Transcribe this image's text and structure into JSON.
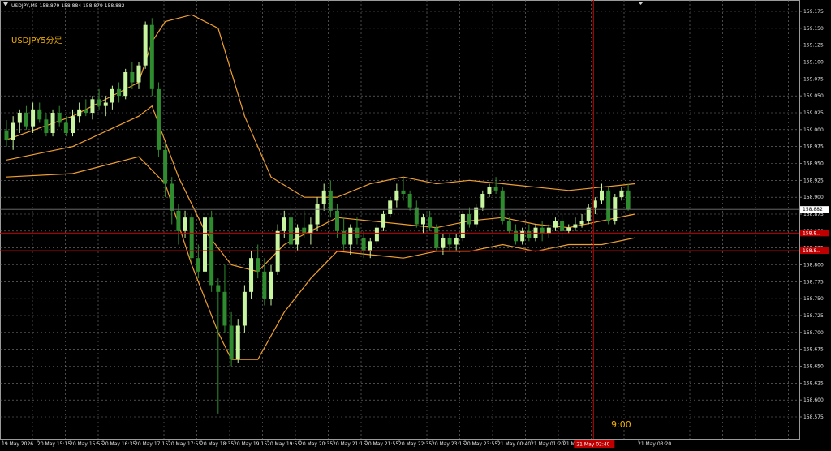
{
  "window": {
    "symbol_header": "USDJPY,M5  158.879 158.884 158.879 158.882",
    "subtitle": "USDJPY5分足"
  },
  "colors": {
    "background": "#000000",
    "grid": "#7a7a7a",
    "bull_candle": "#c8f5a0",
    "bear_candle": "#2e8b2e",
    "bollinger": "#f0a030",
    "level_line": "#c00000",
    "crosshair": "#c00000",
    "price_tag_red": "#c00000",
    "current_price_tag": "#ffffff",
    "axis_text": "#e6e6e6",
    "subtitle_text": "#f0b000"
  },
  "price_axis": {
    "labels": [
      "159.175",
      "159.150",
      "159.125",
      "159.100",
      "159.075",
      "159.050",
      "159.025",
      "159.000",
      "158.975",
      "158.950",
      "158.925",
      "158.900",
      "158.875",
      "158.850",
      "158.825",
      "158.800",
      "158.775",
      "158.750",
      "158.725",
      "158.700",
      "158.675",
      "158.650",
      "158.625",
      "158.600",
      "158.575"
    ],
    "current_price": "158.882",
    "level_tags": [
      "158.8..",
      "158.8.."
    ]
  },
  "time_axis": {
    "labels": [
      "19 May 2026",
      "20 May 15:15",
      "20 May 15:55",
      "20 May 16:35",
      "20 May 17:15",
      "20 May 17:55",
      "20 May 18:35",
      "20 May 19:15",
      "20 May 19:55",
      "20 May 20:35",
      "20 May 21:15",
      "20 May 21:55",
      "20 May 22:35",
      "20 May 23:15",
      "20 May 23:55",
      "21 May 00:40",
      "21 May 01:20",
      "21 May 02:00",
      "21 May 03:20"
    ],
    "crosshair_time_tag": "21 May 02:40"
  },
  "crosshair_label": "9:00",
  "chart_data": {
    "type": "candlestick",
    "symbol": "USDJPY",
    "timeframe": "M5",
    "ylim": [
      158.575,
      159.175
    ],
    "grid": true,
    "levels": [
      158.847,
      158.821
    ],
    "last_close": 158.882,
    "candles": [
      [
        158.999,
        159.014,
        158.975,
        158.985
      ],
      [
        158.985,
        159.02,
        158.97,
        159.01
      ],
      [
        159.01,
        159.03,
        158.995,
        159.025
      ],
      [
        159.025,
        159.035,
        159.0,
        159.005
      ],
      [
        159.005,
        159.04,
        158.995,
        159.03
      ],
      [
        159.03,
        159.04,
        159.01,
        159.015
      ],
      [
        159.015,
        159.025,
        158.99,
        158.995
      ],
      [
        158.995,
        159.03,
        158.99,
        159.025
      ],
      [
        159.025,
        159.035,
        159.005,
        159.01
      ],
      [
        159.01,
        159.02,
        158.99,
        158.995
      ],
      [
        158.995,
        159.03,
        158.99,
        159.02
      ],
      [
        159.02,
        159.04,
        159.01,
        159.03
      ],
      [
        159.03,
        159.045,
        159.02,
        159.025
      ],
      [
        159.025,
        159.05,
        159.015,
        159.045
      ],
      [
        159.045,
        159.06,
        159.03,
        159.035
      ],
      [
        159.035,
        159.05,
        159.02,
        159.04
      ],
      [
        159.04,
        159.065,
        159.03,
        159.06
      ],
      [
        159.06,
        159.07,
        159.04,
        159.05
      ],
      [
        159.05,
        159.09,
        159.045,
        159.085
      ],
      [
        159.085,
        159.1,
        159.06,
        159.07
      ],
      [
        159.07,
        159.1,
        159.06,
        159.095
      ],
      [
        159.095,
        159.16,
        159.09,
        159.155
      ],
      [
        159.155,
        159.165,
        159.05,
        159.06
      ],
      [
        159.06,
        159.07,
        158.96,
        158.97
      ],
      [
        158.97,
        158.98,
        158.9,
        158.92
      ],
      [
        158.92,
        158.93,
        158.86,
        158.88
      ],
      [
        158.88,
        158.89,
        158.83,
        158.85
      ],
      [
        158.85,
        158.88,
        158.84,
        158.87
      ],
      [
        158.87,
        158.875,
        158.8,
        158.81
      ],
      [
        158.81,
        158.83,
        158.78,
        158.79
      ],
      [
        158.79,
        158.88,
        158.78,
        158.87
      ],
      [
        158.87,
        158.88,
        158.76,
        158.77
      ],
      [
        158.77,
        158.78,
        158.58,
        158.76
      ],
      [
        158.76,
        158.8,
        158.7,
        158.71
      ],
      [
        158.71,
        158.73,
        158.65,
        158.66
      ],
      [
        158.66,
        158.72,
        158.655,
        158.71
      ],
      [
        158.71,
        158.77,
        158.7,
        158.76
      ],
      [
        158.76,
        158.82,
        158.75,
        158.81
      ],
      [
        158.81,
        158.83,
        158.78,
        158.79
      ],
      [
        158.79,
        158.81,
        158.74,
        158.75
      ],
      [
        158.75,
        158.8,
        158.74,
        158.79
      ],
      [
        158.79,
        158.86,
        158.785,
        158.85
      ],
      [
        158.85,
        158.88,
        158.84,
        158.87
      ],
      [
        158.87,
        158.89,
        158.82,
        158.83
      ],
      [
        158.83,
        158.86,
        158.82,
        158.855
      ],
      [
        158.855,
        158.88,
        158.84,
        158.845
      ],
      [
        158.845,
        158.87,
        158.83,
        158.86
      ],
      [
        158.86,
        158.9,
        158.85,
        158.89
      ],
      [
        158.89,
        158.92,
        158.88,
        158.91
      ],
      [
        158.91,
        158.925,
        158.87,
        158.88
      ],
      [
        158.88,
        158.89,
        158.84,
        158.85
      ],
      [
        158.85,
        158.87,
        158.82,
        158.83
      ],
      [
        158.83,
        158.86,
        158.815,
        158.855
      ],
      [
        158.855,
        158.87,
        158.83,
        158.84
      ],
      [
        158.84,
        158.85,
        158.81,
        158.82
      ],
      [
        158.82,
        158.84,
        158.81,
        158.835
      ],
      [
        158.835,
        158.86,
        158.83,
        158.855
      ],
      [
        158.855,
        158.88,
        158.85,
        158.875
      ],
      [
        158.875,
        158.9,
        158.87,
        158.895
      ],
      [
        158.895,
        158.92,
        158.885,
        158.91
      ],
      [
        158.91,
        158.93,
        158.895,
        158.905
      ],
      [
        158.905,
        158.91,
        158.88,
        158.885
      ],
      [
        158.885,
        158.895,
        158.855,
        158.86
      ],
      [
        158.86,
        158.875,
        158.845,
        158.87
      ],
      [
        158.87,
        158.88,
        158.85,
        158.855
      ],
      [
        158.855,
        158.86,
        158.82,
        158.825
      ],
      [
        158.825,
        158.845,
        158.815,
        158.84
      ],
      [
        158.84,
        158.845,
        158.82,
        158.83
      ],
      [
        158.83,
        158.845,
        158.82,
        158.84
      ],
      [
        158.84,
        158.88,
        158.835,
        158.875
      ],
      [
        158.875,
        158.885,
        158.855,
        158.86
      ],
      [
        158.86,
        158.89,
        158.855,
        158.885
      ],
      [
        158.885,
        158.91,
        158.88,
        158.905
      ],
      [
        158.905,
        158.92,
        158.9,
        158.915
      ],
      [
        158.915,
        158.93,
        158.905,
        158.91
      ],
      [
        158.91,
        158.915,
        158.86,
        158.865
      ],
      [
        158.865,
        158.87,
        158.845,
        158.85
      ],
      [
        158.85,
        158.86,
        158.83,
        158.835
      ],
      [
        158.835,
        158.855,
        158.83,
        158.85
      ],
      [
        158.85,
        158.86,
        158.835,
        158.84
      ],
      [
        158.84,
        158.86,
        158.835,
        158.855
      ],
      [
        158.855,
        158.865,
        158.835,
        158.845
      ],
      [
        158.845,
        158.86,
        158.84,
        158.855
      ],
      [
        158.855,
        158.87,
        158.85,
        158.865
      ],
      [
        158.865,
        158.875,
        158.84,
        158.85
      ],
      [
        158.85,
        158.86,
        158.845,
        158.855
      ],
      [
        158.855,
        158.87,
        158.85,
        158.86
      ],
      [
        158.86,
        158.875,
        158.855,
        158.865
      ],
      [
        158.865,
        158.89,
        158.86,
        158.885
      ],
      [
        158.885,
        158.9,
        158.875,
        158.895
      ],
      [
        158.895,
        158.92,
        158.89,
        158.91
      ],
      [
        158.91,
        158.915,
        158.86,
        158.865
      ],
      [
        158.865,
        158.905,
        158.86,
        158.9
      ],
      [
        158.9,
        158.915,
        158.895,
        158.91
      ],
      [
        158.91,
        158.92,
        158.88,
        158.882
      ]
    ],
    "bollinger_upper": [
      [
        0,
        158.985
      ],
      [
        10,
        159.02
      ],
      [
        20,
        159.07
      ],
      [
        22,
        159.13
      ],
      [
        24,
        159.16
      ],
      [
        28,
        159.17
      ],
      [
        32,
        159.15
      ],
      [
        36,
        159.02
      ],
      [
        40,
        158.93
      ],
      [
        45,
        158.9
      ],
      [
        50,
        158.9
      ],
      [
        55,
        158.92
      ],
      [
        60,
        158.93
      ],
      [
        65,
        158.92
      ],
      [
        70,
        158.925
      ],
      [
        75,
        158.92
      ],
      [
        80,
        158.915
      ],
      [
        85,
        158.91
      ],
      [
        90,
        158.915
      ],
      [
        95,
        158.92
      ]
    ],
    "bollinger_middle": [
      [
        0,
        158.955
      ],
      [
        10,
        158.975
      ],
      [
        20,
        159.02
      ],
      [
        22,
        159.035
      ],
      [
        26,
        158.93
      ],
      [
        30,
        158.85
      ],
      [
        34,
        158.8
      ],
      [
        38,
        158.79
      ],
      [
        42,
        158.83
      ],
      [
        46,
        158.85
      ],
      [
        50,
        158.87
      ],
      [
        55,
        158.865
      ],
      [
        60,
        158.86
      ],
      [
        65,
        158.855
      ],
      [
        70,
        158.865
      ],
      [
        75,
        158.87
      ],
      [
        80,
        158.86
      ],
      [
        85,
        158.855
      ],
      [
        90,
        158.865
      ],
      [
        95,
        158.875
      ]
    ],
    "bollinger_lower": [
      [
        0,
        158.93
      ],
      [
        10,
        158.935
      ],
      [
        20,
        158.96
      ],
      [
        24,
        158.92
      ],
      [
        28,
        158.8
      ],
      [
        32,
        158.7
      ],
      [
        34,
        158.66
      ],
      [
        38,
        158.66
      ],
      [
        42,
        158.73
      ],
      [
        46,
        158.78
      ],
      [
        50,
        158.82
      ],
      [
        55,
        158.815
      ],
      [
        60,
        158.81
      ],
      [
        65,
        158.82
      ],
      [
        70,
        158.82
      ],
      [
        75,
        158.83
      ],
      [
        80,
        158.82
      ],
      [
        85,
        158.83
      ],
      [
        90,
        158.83
      ],
      [
        95,
        158.84
      ]
    ],
    "crosshair_candle_index": 89
  }
}
